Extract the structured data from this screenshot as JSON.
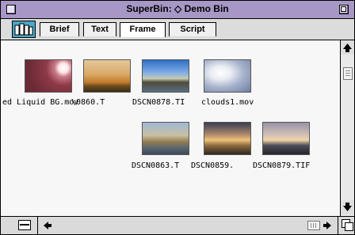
{
  "window": {
    "title": "SuperBin: ◇ Demo Bin"
  },
  "tabs": [
    {
      "label": "Brief",
      "active": false
    },
    {
      "label": "Text",
      "active": false
    },
    {
      "label": "Frame",
      "active": true
    },
    {
      "label": "Script",
      "active": false
    }
  ],
  "clips": [
    {
      "label": "ed Liquid BG.mov",
      "thumbnail": "red-liquid-abstract"
    },
    {
      "label": "\\0860.T",
      "thumbnail": "sunset-harbor"
    },
    {
      "label": "DSCN0878.TI",
      "thumbnail": "waterfront-city-blue-sky"
    },
    {
      "label": "clouds1.mov",
      "thumbnail": "cloudy-sky"
    },
    {
      "label": "DSCN0863.T",
      "thumbnail": "city-skyline-golden"
    },
    {
      "label": "DSCN0859.",
      "thumbnail": "sunset-over-water"
    },
    {
      "label": "DSCN0879.TIF",
      "thumbnail": "city-skyline-dusk"
    }
  ],
  "colors": {
    "titlebar": "#a797c6",
    "icon_bg": "#4aa6c9",
    "content_bg": "#f7f7f7"
  }
}
